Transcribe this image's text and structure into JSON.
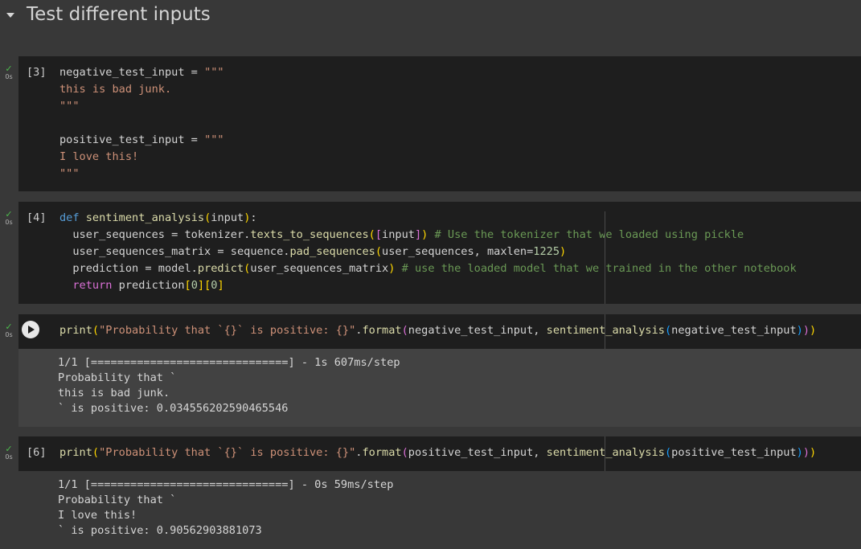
{
  "section": {
    "title": "Test different inputs"
  },
  "cells": [
    {
      "exec_count": "[3]",
      "runtime": "0s",
      "lines": [
        [
          {
            "t": "negative_test_input = ",
            "c": "def"
          },
          {
            "t": "\"\"\"",
            "c": "str"
          }
        ],
        [
          {
            "t": "this is bad junk.",
            "c": "str"
          }
        ],
        [
          {
            "t": "\"\"\"",
            "c": "str"
          }
        ],
        [
          {
            "t": "",
            "c": "def"
          }
        ],
        [
          {
            "t": "positive_test_input = ",
            "c": "def"
          },
          {
            "t": "\"\"\"",
            "c": "str"
          }
        ],
        [
          {
            "t": "I love this!",
            "c": "str"
          }
        ],
        [
          {
            "t": "\"\"\"",
            "c": "str"
          }
        ]
      ]
    },
    {
      "exec_count": "[4]",
      "runtime": "0s",
      "lines": [
        [
          {
            "t": "def ",
            "c": "kw"
          },
          {
            "t": "sentiment_analysis",
            "c": "fn"
          },
          {
            "t": "(",
            "c": "p1"
          },
          {
            "t": "input",
            "c": "def"
          },
          {
            "t": ")",
            "c": "p1"
          },
          {
            "t": ":",
            "c": "def"
          }
        ],
        [
          {
            "t": "  user_sequences = tokenizer.",
            "c": "def"
          },
          {
            "t": "texts_to_sequences",
            "c": "fn"
          },
          {
            "t": "(",
            "c": "p1"
          },
          {
            "t": "[",
            "c": "p2"
          },
          {
            "t": "input",
            "c": "def"
          },
          {
            "t": "]",
            "c": "p2"
          },
          {
            "t": ")",
            "c": "p1"
          },
          {
            "t": " # Use the tokenizer that we loaded using pickle",
            "c": "cm"
          }
        ],
        [
          {
            "t": "  user_sequences_matrix = sequence.",
            "c": "def"
          },
          {
            "t": "pad_sequences",
            "c": "fn"
          },
          {
            "t": "(",
            "c": "p1"
          },
          {
            "t": "user_sequences, maxlen=",
            "c": "def"
          },
          {
            "t": "1225",
            "c": "num"
          },
          {
            "t": ")",
            "c": "p1"
          }
        ],
        [
          {
            "t": "  prediction = model.",
            "c": "def"
          },
          {
            "t": "predict",
            "c": "fn"
          },
          {
            "t": "(",
            "c": "p1"
          },
          {
            "t": "user_sequences_matrix",
            "c": "def"
          },
          {
            "t": ")",
            "c": "p1"
          },
          {
            "t": " # use the loaded model that we trained in the other notebook",
            "c": "cm"
          }
        ],
        [
          {
            "t": "  ",
            "c": "def"
          },
          {
            "t": "return ",
            "c": "p2"
          },
          {
            "t": "prediction",
            "c": "def"
          },
          {
            "t": "[",
            "c": "p1"
          },
          {
            "t": "0",
            "c": "num"
          },
          {
            "t": "]",
            "c": "p1"
          },
          {
            "t": "[",
            "c": "p1"
          },
          {
            "t": "0",
            "c": "num"
          },
          {
            "t": "]",
            "c": "p1"
          }
        ]
      ]
    },
    {
      "exec_count": "",
      "runtime": "0s",
      "lines": [
        [
          {
            "t": "print",
            "c": "fn"
          },
          {
            "t": "(",
            "c": "p1"
          },
          {
            "t": "\"Probability that `{}` is positive: {}\"",
            "c": "str"
          },
          {
            "t": ".",
            "c": "def"
          },
          {
            "t": "format",
            "c": "fn"
          },
          {
            "t": "(",
            "c": "p2"
          },
          {
            "t": "negative_test_input, ",
            "c": "def"
          },
          {
            "t": "sentiment_analysis",
            "c": "fn"
          },
          {
            "t": "(",
            "c": "p3"
          },
          {
            "t": "negative_test_input",
            "c": "def"
          },
          {
            "t": ")",
            "c": "p3"
          },
          {
            "t": ")",
            "c": "p2"
          },
          {
            "t": ")",
            "c": "p1"
          }
        ]
      ],
      "output": [
        "1/1 [==============================] - 1s 607ms/step",
        "Probability that `",
        "this is bad junk.",
        "` is positive: 0.034556202590465546"
      ]
    },
    {
      "exec_count": "[6]",
      "runtime": "0s",
      "lines": [
        [
          {
            "t": "print",
            "c": "fn"
          },
          {
            "t": "(",
            "c": "p1"
          },
          {
            "t": "\"Probability that `{}` is positive: {}\"",
            "c": "str"
          },
          {
            "t": ".",
            "c": "def"
          },
          {
            "t": "format",
            "c": "fn"
          },
          {
            "t": "(",
            "c": "p2"
          },
          {
            "t": "positive_test_input, ",
            "c": "def"
          },
          {
            "t": "sentiment_analysis",
            "c": "fn"
          },
          {
            "t": "(",
            "c": "p3"
          },
          {
            "t": "positive_test_input",
            "c": "def"
          },
          {
            "t": ")",
            "c": "p3"
          },
          {
            "t": ")",
            "c": "p2"
          },
          {
            "t": ")",
            "c": "p1"
          }
        ]
      ],
      "output": [
        "1/1 [==============================] - 0s 59ms/step",
        "Probability that `",
        "I love this!",
        "` is positive: 0.90562903881073"
      ]
    }
  ]
}
